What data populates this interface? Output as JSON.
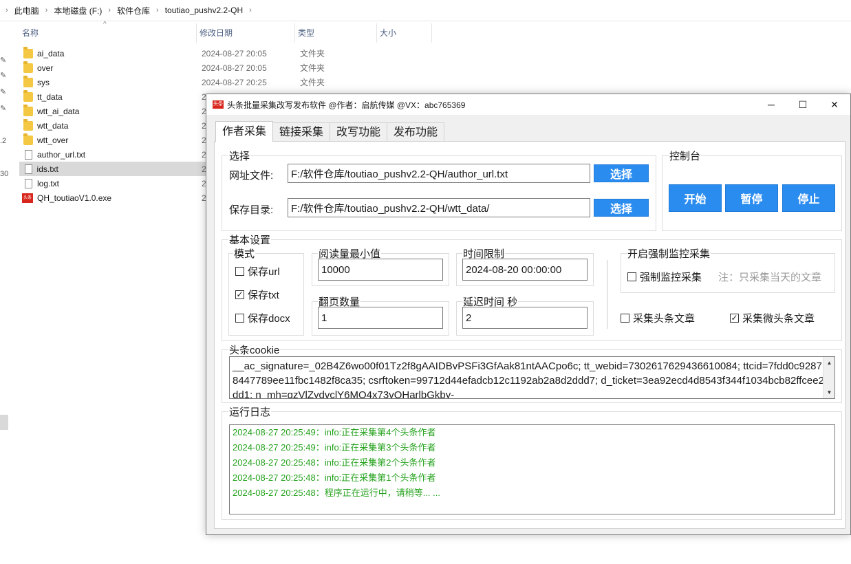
{
  "explorer": {
    "breadcrumbs": [
      "此电脑",
      "本地磁盘 (F:)",
      "软件仓库",
      "toutiao_pushv2.2-QH"
    ],
    "columns": {
      "name": "名称",
      "date": "修改日期",
      "type": "类型",
      "size": "大小"
    },
    "files": [
      {
        "name": "ai_data",
        "date": "2024-08-27 20:05",
        "type": "文件夹",
        "icon": "folder-icon"
      },
      {
        "name": "over",
        "date": "2024-08-27 20:05",
        "type": "文件夹",
        "icon": "folder-icon"
      },
      {
        "name": "sys",
        "date": "2024-08-27 20:25",
        "type": "文件夹",
        "icon": "folder-icon"
      },
      {
        "name": "tt_data",
        "date": "2",
        "type": "",
        "icon": "folder-icon"
      },
      {
        "name": "wtt_ai_data",
        "date": "2",
        "type": "",
        "icon": "folder-icon"
      },
      {
        "name": "wtt_data",
        "date": "2",
        "type": "",
        "icon": "folder-icon"
      },
      {
        "name": "wtt_over",
        "date": "2",
        "type": "",
        "icon": "folder-icon"
      },
      {
        "name": "author_url.txt",
        "date": "2",
        "type": "",
        "icon": "text-file-icon"
      },
      {
        "name": "ids.txt",
        "date": "2",
        "type": "",
        "icon": "text-file-icon",
        "selected": true
      },
      {
        "name": "log.txt",
        "date": "2",
        "type": "",
        "icon": "text-file-icon"
      },
      {
        "name": "QH_toutiaoV1.0.exe",
        "date": "2",
        "type": "",
        "icon": "exe-file-icon"
      }
    ],
    "left_markers": [
      ".2",
      "30"
    ],
    "exe_icon_text": "头条"
  },
  "app": {
    "title": "头条批量采集改写发布软件 @作者：启航传媒 @VX：abc765369",
    "logo_text": "头条",
    "tabs": [
      "作者采集",
      "链接采集",
      "改写功能",
      "发布功能"
    ],
    "select_group": {
      "legend": "选择",
      "url_file_label": "网址文件:",
      "url_file_value": "F:/软件仓库/toutiao_pushv2.2-QH/author_url.txt",
      "save_dir_label": "保存目录:",
      "save_dir_value": "F:/软件仓库/toutiao_pushv2.2-QH/wtt_data/",
      "choose_label": "选择"
    },
    "console": {
      "legend": "控制台",
      "start": "开始",
      "pause": "暂停",
      "stop": "停止"
    },
    "basic": {
      "legend": "基本设置",
      "mode_legend": "模式",
      "save_url": "保存url",
      "save_url_checked": false,
      "save_txt": "保存txt",
      "save_txt_checked": true,
      "save_docx": "保存docx",
      "save_docx_checked": false,
      "min_read_legend": "阅读量最小值",
      "min_read_value": "10000",
      "time_limit_legend": "时间限制",
      "time_limit_value": "2024-08-20 00:00:00",
      "pages_legend": "翻页数量",
      "pages_value": "1",
      "delay_legend": "延迟时间 秒",
      "delay_value": "2",
      "monitor_legend": "开启强制监控采集",
      "monitor_label": "强制监控采集",
      "monitor_checked": false,
      "monitor_hint": "注：只采集当天的文章",
      "collect_toutiao": "采集头条文章",
      "collect_toutiao_checked": false,
      "collect_wtt": "采集微头条文章",
      "collect_wtt_checked": true
    },
    "cookie": {
      "legend": "头条cookie",
      "value": "__ac_signature=_02B4Z6wo00f01Tz2f8gAAIDBvPSFi3GfAak81ntAACpo6c; tt_webid=7302617629436610084; ttcid=7fdd0c92878447789ee11fbc1482f8ca35; csrftoken=99712d44efadcb12c1192ab2a8d2ddd7; d_ticket=3ea92ecd4d8543f344f1034bcb82ffcee2dd1; n_mh=gzVlZydvclY6MO4x73vQHarlbGkby-"
    },
    "log": {
      "legend": "运行日志",
      "lines": [
        "2024-08-27 20:25:49：info:正在采集第4个头条作者",
        "2024-08-27 20:25:49：info:正在采集第3个头条作者",
        "2024-08-27 20:25:48：info:正在采集第2个头条作者",
        "2024-08-27 20:25:48：info:正在采集第1个头条作者",
        "2024-08-27 20:25:48：程序正在运行中，请稍等... ..."
      ],
      "color": "#24a21c"
    },
    "colors": {
      "accent": "#2b8cf0",
      "logo": "#d8261c"
    }
  }
}
